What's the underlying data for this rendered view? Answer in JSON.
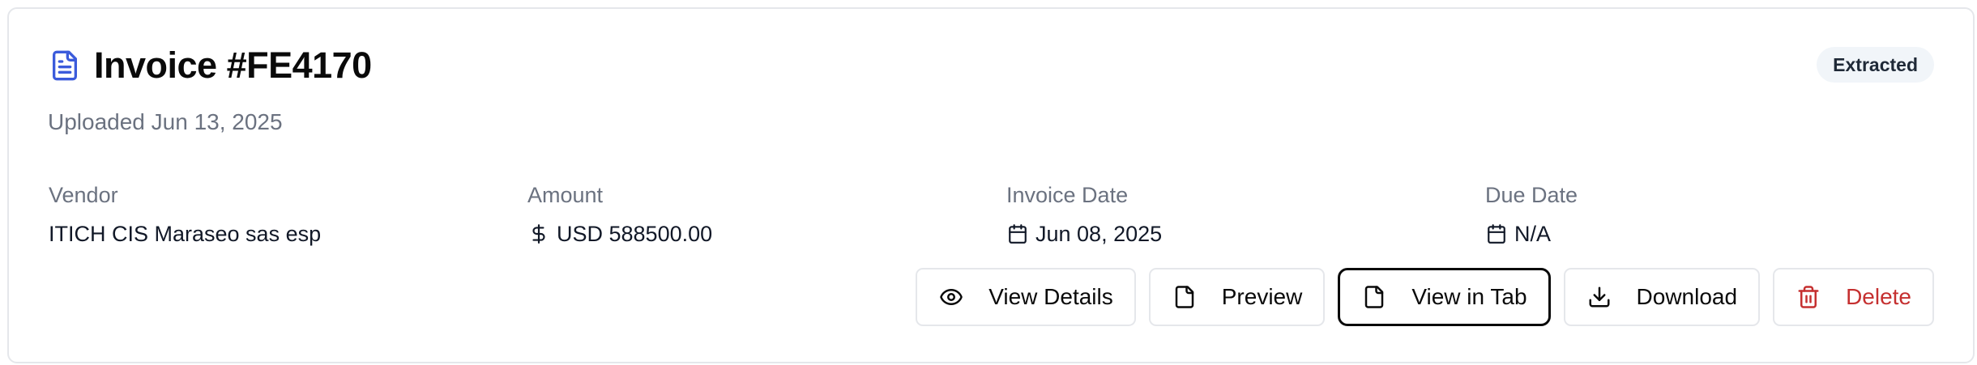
{
  "invoice": {
    "title": "Invoice #FE4170",
    "uploaded": "Uploaded Jun 13, 2025",
    "status": "Extracted"
  },
  "fields": {
    "vendor": {
      "label": "Vendor",
      "value": "ITICH CIS Maraseo sas esp"
    },
    "amount": {
      "label": "Amount",
      "value": "USD 588500.00"
    },
    "invoice_date": {
      "label": "Invoice Date",
      "value": "Jun 08, 2025"
    },
    "due_date": {
      "label": "Due Date",
      "value": "N/A"
    }
  },
  "actions": {
    "view_details": "View Details",
    "preview": "Preview",
    "view_in_tab": "View in Tab",
    "download": "Download",
    "delete": "Delete"
  },
  "icons": {
    "title": "file-text-icon",
    "amount": "dollar-icon",
    "dates": "calendar-icon",
    "view_details": "eye-icon",
    "preview": "file-icon",
    "view_in_tab": "file-icon",
    "download": "download-icon",
    "delete": "trash-icon"
  },
  "colors": {
    "accent": "#3b5bdb",
    "danger": "#c53030",
    "muted": "#6b7280",
    "badge_bg": "#f1f5f9"
  }
}
